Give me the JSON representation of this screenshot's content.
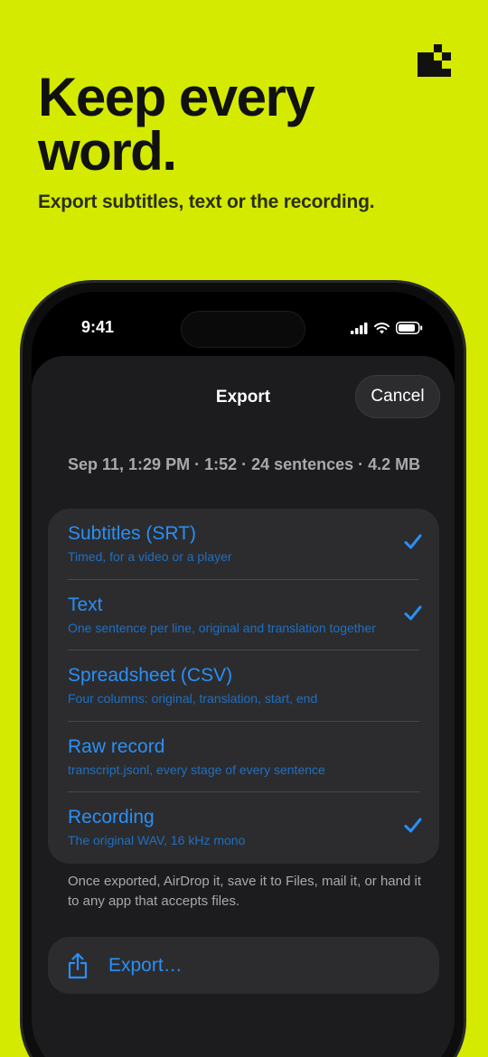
{
  "promo": {
    "headline": "Keep every word.",
    "subline": "Export subtitles, text or the recording."
  },
  "status_bar": {
    "time": "9:41",
    "icons": [
      "cellular-signal-icon",
      "wifi-icon",
      "battery-icon"
    ]
  },
  "sheet": {
    "title": "Export",
    "cancel_label": "Cancel",
    "meta": "Sep 11, 1:29 PM · 1:52 · 24 sentences · 4.2 MB",
    "options": [
      {
        "label": "Subtitles (SRT)",
        "description": "Timed, for a video or a player",
        "selected": true
      },
      {
        "label": "Text",
        "description": "One sentence per line, original and translation together",
        "selected": true
      },
      {
        "label": "Spreadsheet (CSV)",
        "description": "Four columns: original, translation, start, end",
        "selected": false
      },
      {
        "label": "Raw record",
        "description": "transcript.jsonl, every stage of every sentence",
        "selected": false
      },
      {
        "label": "Recording",
        "description": "The original WAV, 16 kHz mono",
        "selected": true
      }
    ],
    "note": "Once exported, AirDrop it, save it to Files, mail it, or hand it to any app that accepts files.",
    "export_label": "Export…"
  },
  "colors": {
    "background": "#d4ea00",
    "accent": "#2a8ff6",
    "sheet": "#1c1c1e",
    "card": "#2c2c2e"
  }
}
